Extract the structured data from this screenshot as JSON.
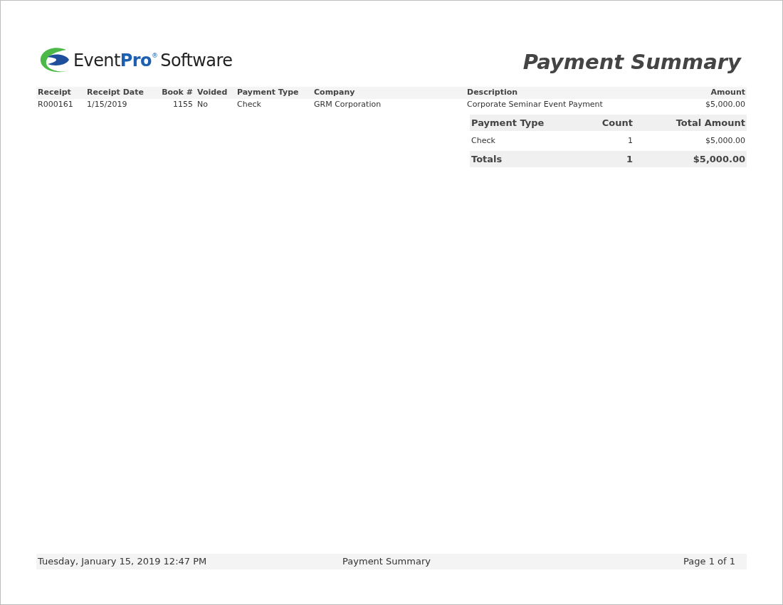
{
  "logo": {
    "word_a": "Event",
    "word_b": "Pro",
    "mark": "®",
    "word_c": "Software"
  },
  "report_title": "Payment Summary",
  "receipts": {
    "columns": [
      "Receipt",
      "Receipt Date",
      "Book #",
      "Voided",
      "Payment Type",
      "Company",
      "Description",
      "Amount"
    ],
    "rows": [
      [
        "R000161",
        "1/15/2019",
        "1155",
        "No",
        "Check",
        "GRM Corporation",
        "Corporate Seminar Event Payment",
        "$5,000.00"
      ]
    ]
  },
  "summary": {
    "columns": [
      "Payment Type",
      "Count",
      "Total Amount"
    ],
    "rows": [
      [
        "Check",
        "1",
        "$5,000.00"
      ]
    ],
    "totals": [
      "Totals",
      "1",
      "$5,000.00"
    ]
  },
  "footer": {
    "printed_at": "Tuesday, January 15, 2019 12:47 PM",
    "report_name": "Payment Summary",
    "page": "Page 1 of 1"
  }
}
